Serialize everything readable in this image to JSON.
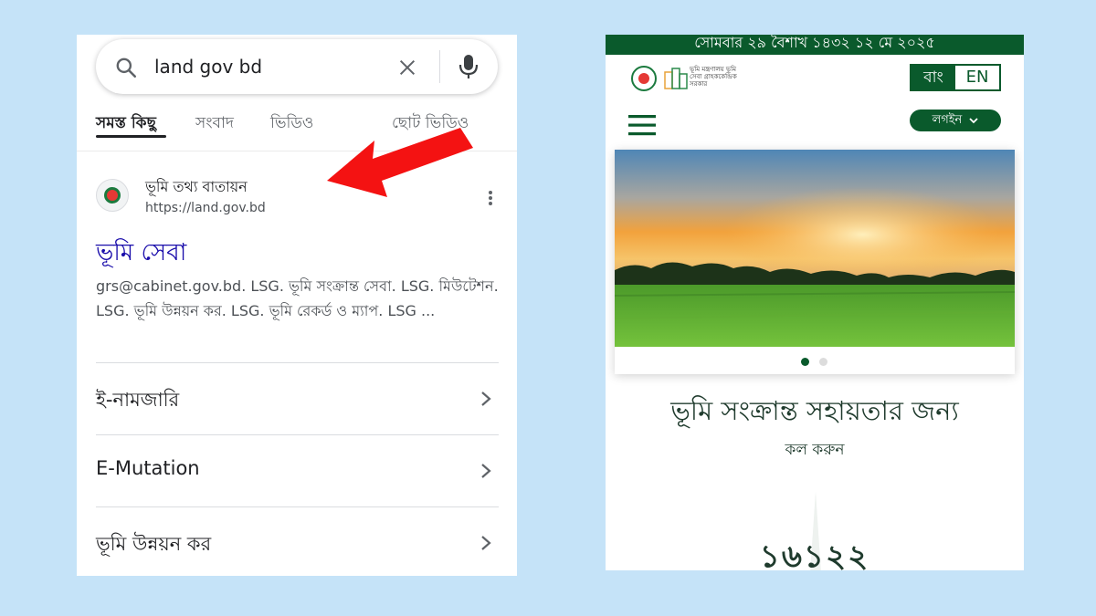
{
  "google": {
    "query": "land gov bd",
    "tabs": [
      "সমস্ত কিছু",
      "সংবাদ",
      "ভিডিও",
      "ছোট ভিডিও"
    ],
    "result": {
      "site_name": "ভূমি তথ্য বাতায়ন",
      "url": "https://land.gov.bd",
      "title": "ভূমি সেবা",
      "snippet": "grs@cabinet.gov.bd. LSG. ভূমি সংক্রান্ত সেবা. LSG. মিউটেশন. LSG. ভূমি উন্নয়ন কর. LSG. ভূমি রেকর্ড ও ম্যাপ. LSG ..."
    },
    "sitelinks": [
      "ই-নামজারি",
      "E-Mutation",
      "ভূমি উন্নয়ন কর"
    ]
  },
  "land_site": {
    "date": "সোমবার ২৯ বৈশাখ ১৪৩২ ১২ মে ২০২৫",
    "logo_text": "ভূমি মন্ত্রণালয় ভূমি সেবা গ্রাহককেন্দ্রিক সরকার",
    "lang_bn": "বাং",
    "lang_en": "EN",
    "login": "লগইন",
    "help_title": "ভূমি সংক্রান্ত সহায়তার জন্য",
    "help_sub": "কল করুন",
    "hotline": "১৬১২২"
  },
  "colors": {
    "site_green": "#0a5a2c",
    "google_link": "#1a0dab",
    "arrow_red": "#f41212",
    "background": "#c5e3f8"
  },
  "icons": [
    "search-icon",
    "clear-icon",
    "mic-icon",
    "more-vert-icon",
    "chevron-right-icon",
    "hamburger-menu-icon",
    "chevron-down-icon",
    "red-arrow-annotation"
  ]
}
